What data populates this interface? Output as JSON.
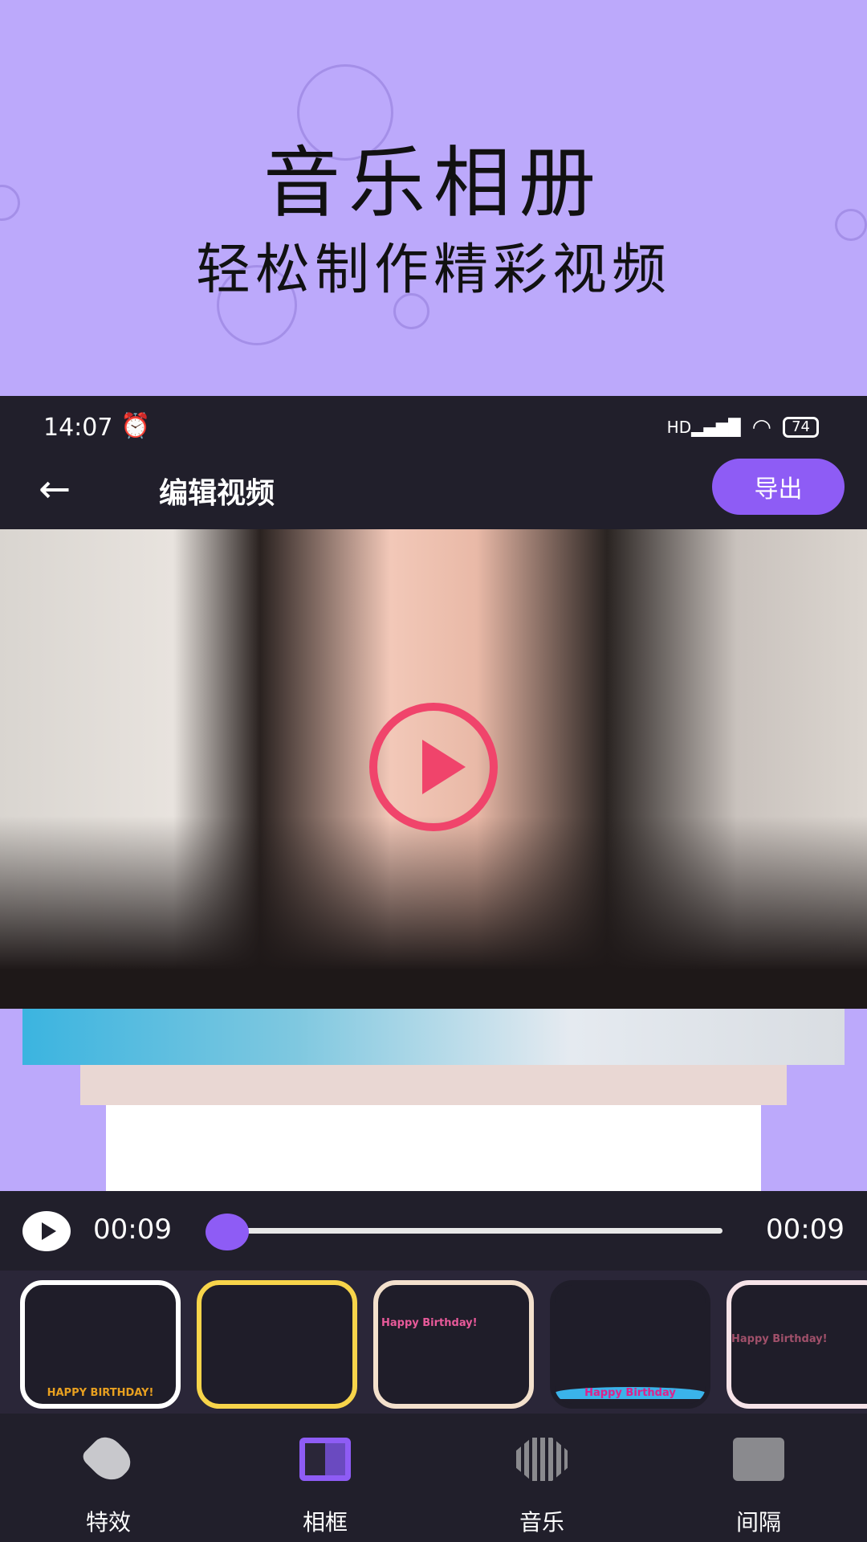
{
  "promo": {
    "title": "音乐相册",
    "subtitle": "轻松制作精彩视频"
  },
  "status_bar": {
    "time": "14:07",
    "network": "HD",
    "battery": "74"
  },
  "app_bar": {
    "title": "编辑视频",
    "export_label": "导出"
  },
  "player": {
    "current_time": "00:09",
    "total_time": "00:09",
    "progress": 0
  },
  "frames": [
    {
      "caption": "HAPPY BIRTHDAY!"
    },
    {
      "caption": ""
    },
    {
      "caption": "Happy Birthday!"
    },
    {
      "caption": "Happy Birthday"
    },
    {
      "caption": "Happy Birthday!"
    }
  ],
  "nav": {
    "items": [
      {
        "label": "特效",
        "icon": "effects-icon",
        "color": "#c8c8cc"
      },
      {
        "label": "相框",
        "icon": "frame-icon",
        "color": "#8e5cf5",
        "active": true
      },
      {
        "label": "音乐",
        "icon": "music-wave-icon",
        "color": "#8a8a8e"
      },
      {
        "label": "间隔",
        "icon": "sliders-icon",
        "color": "#8a8a8e"
      }
    ]
  },
  "colors": {
    "accent": "#8e5cf5",
    "background": "#bca9fb",
    "dark": "#211f2b",
    "play": "#f0446b"
  }
}
